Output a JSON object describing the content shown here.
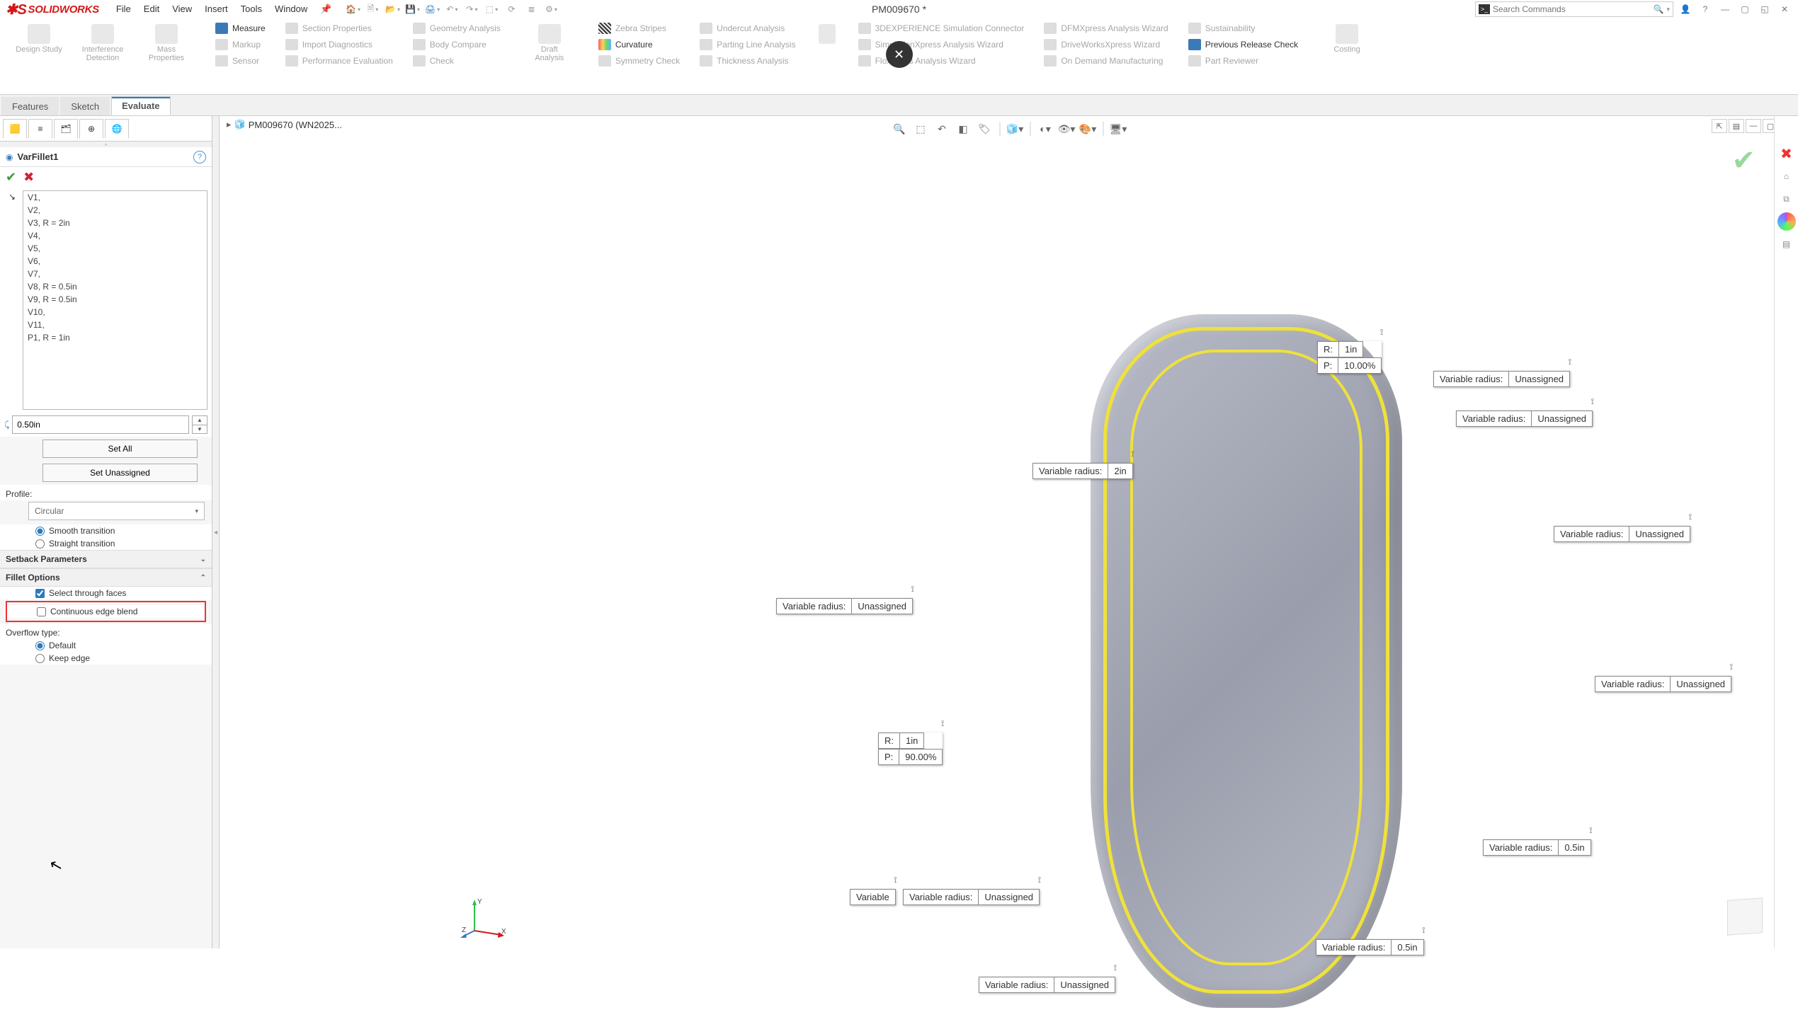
{
  "app": {
    "name": "SOLIDWORKS",
    "doc_title": "PM009670 *"
  },
  "menu": [
    "File",
    "Edit",
    "View",
    "Insert",
    "Tools",
    "Window"
  ],
  "search": {
    "placeholder": "Search Commands"
  },
  "ribbon": {
    "big": [
      {
        "label": "Design Study"
      },
      {
        "label": "Interference\nDetection"
      },
      {
        "label": "Mass\nProperties"
      }
    ],
    "col1": [
      {
        "label": "Measure",
        "active": true
      },
      {
        "label": "Markup"
      },
      {
        "label": "Sensor"
      }
    ],
    "col2": [
      {
        "label": "Section Properties"
      },
      {
        "label": "Import Diagnostics"
      },
      {
        "label": "Performance Evaluation"
      }
    ],
    "col3": [
      {
        "label": "Geometry Analysis"
      },
      {
        "label": "Body Compare"
      },
      {
        "label": "Check"
      }
    ],
    "big2": [
      {
        "label": "Draft\nAnalysis"
      }
    ],
    "col4": [
      {
        "label": "Zebra Stripes"
      },
      {
        "label": "Curvature",
        "active": true
      },
      {
        "label": "Symmetry Check"
      }
    ],
    "col5": [
      {
        "label": "Undercut Analysis"
      },
      {
        "label": "Parting Line Analysis"
      },
      {
        "label": "Thickness Analysis"
      }
    ],
    "col6": [
      {
        "label": "3DEXPERIENCE Simulation Connector"
      },
      {
        "label": "SimulationXpress Analysis Wizard"
      },
      {
        "label": "FloXpress Analysis Wizard"
      }
    ],
    "col7": [
      {
        "label": "DFMXpress Analysis Wizard"
      },
      {
        "label": "DriveWorksXpress Wizard"
      },
      {
        "label": "On Demand Manufacturing"
      }
    ],
    "col8": [
      {
        "label": "Sustainability"
      },
      {
        "label": "Previous Release Check",
        "active": true
      },
      {
        "label": "Part Reviewer"
      }
    ],
    "big3": [
      {
        "label": "Costing"
      }
    ]
  },
  "tabs": [
    "Features",
    "Sketch",
    "Evaluate"
  ],
  "tabs_active": 2,
  "breadcrumb": "PM009670 (WN2025...",
  "pm": {
    "feature": "VarFillet1",
    "vlist": [
      "V1,",
      "V2,",
      "V3, R = 2in",
      "V4,",
      "V5,",
      "V6,",
      "V7,",
      "V8, R = 0.5in",
      "V9, R = 0.5in",
      "V10,",
      "V11,",
      "P1, R = 1in"
    ],
    "radius": "0.50in",
    "btn_setall": "Set All",
    "btn_setun": "Set Unassigned",
    "profile_lbl": "Profile:",
    "profile_sel": "Circular",
    "trans_smooth": "Smooth transition",
    "trans_straight": "Straight transition",
    "setback_hdr": "Setback Parameters",
    "fillet_hdr": "Fillet Options",
    "sel_through": "Select through faces",
    "cont_edge": "Continuous edge blend",
    "overflow_lbl": "Overflow type:",
    "ov_default": "Default",
    "ov_keep": "Keep edge"
  },
  "callouts": {
    "c1": {
      "l": "Variable radius:",
      "v": "2in"
    },
    "c2": {
      "l": "Variable radius:",
      "v": "Unassigned"
    },
    "c3": {
      "l": "Variable radius:",
      "v": "Unassigned"
    },
    "c4": {
      "l": "Variable radius:",
      "v": "Unassigned"
    },
    "c5": {
      "l": "Variable radius:",
      "v": "Unassigned"
    },
    "c6": {
      "l": "Variable radius:",
      "v": "0.5in"
    },
    "c7": {
      "l": "Variable radius:",
      "v": "0.5in"
    },
    "c8": {
      "l": "Variable radius:",
      "v": "Unassigned"
    },
    "c9": {
      "l": "Variable",
      "v": ""
    },
    "c10": {
      "l": "Variable radius:",
      "v": "Unassigned"
    },
    "c11": {
      "l": "Variable radius:",
      "v": "Unassigned"
    },
    "rp1": {
      "r": "R:",
      "rv": "1in",
      "p": "P:",
      "pv": "10.00%"
    },
    "rp2": {
      "r": "R:",
      "rv": "1in",
      "p": "P:",
      "pv": "90.00%"
    }
  }
}
